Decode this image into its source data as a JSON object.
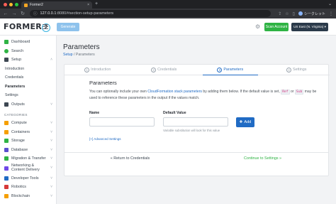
{
  "browser": {
    "tab_title": "Former2",
    "tab_close": "×",
    "new_tab": "+",
    "url_host": "127.0.0.1",
    "url_path": ":8080/#section-setup-parameters",
    "profile_name": "シークレット",
    "colors": {
      "dot_red": "#ff5f57",
      "dot_yellow": "#febc2e",
      "dot_green": "#28c840"
    }
  },
  "header": {
    "logo_text": "FORMER",
    "logo_number": "2",
    "generate_label": "Generate",
    "scan_label": "Scan Account",
    "region_label": "US East (N. Virginia) ▾"
  },
  "sidebar": {
    "top_items": [
      {
        "label": "Dashboard",
        "icon": "dashboard-icon",
        "color": "#2fb344"
      },
      {
        "label": "Search",
        "icon": "search-icon",
        "color": "#2fb344"
      },
      {
        "label": "Setup",
        "icon": "setup-icon",
        "color": "#3d4752"
      }
    ],
    "setup_sub": [
      "Introduction",
      "Credentials",
      "Parameters",
      "Settings"
    ],
    "outputs": {
      "label": "Outputs",
      "icon": "outputs-icon",
      "color": "#3d4752"
    },
    "categories_label": "CATEGORIES",
    "categories": [
      {
        "label": "Compute",
        "color": "#f59f00"
      },
      {
        "label": "Containers",
        "color": "#f59f00"
      },
      {
        "label": "Storage",
        "color": "#2fb344"
      },
      {
        "label": "Database",
        "color": "#5a4fcf"
      },
      {
        "label": "Migration & Transfer",
        "color": "#2fb344"
      },
      {
        "label": "Networking & Content Delivery",
        "color": "#7048e8"
      },
      {
        "label": "Developer Tools",
        "color": "#206bc4"
      },
      {
        "label": "Robotics",
        "color": "#d63939"
      },
      {
        "label": "Blockchain",
        "color": "#f59f00"
      }
    ]
  },
  "main": {
    "title": "Parameters",
    "crumb_setup": "Setup",
    "crumb_sep": "/",
    "crumb_current": "Parameters",
    "steps": [
      {
        "num": "1",
        "label": "Introduction"
      },
      {
        "num": "2",
        "label": "Credentials"
      },
      {
        "num": "3",
        "label": "Parameters"
      },
      {
        "num": "4",
        "label": "Settings"
      }
    ],
    "section_title": "Parameters",
    "desc_1": "You can optionally include your own ",
    "desc_link": "CloudFormation stack parameters",
    "desc_2": " by adding them below. If the default value is set, ",
    "code_ref": "Ref",
    "desc_3": " or ",
    "code_sub": "Sub",
    "desc_4": " may be used to reference these parameters in the output if the values match.",
    "name_label": "Name",
    "default_label": "Default Value",
    "default_help": "Variable substitution will look for this value",
    "add_label": "Add",
    "advanced_link": "[+] Advanced Settings",
    "back_label": "« Return to Credentials",
    "continue_label": "Continue to Settings »"
  }
}
